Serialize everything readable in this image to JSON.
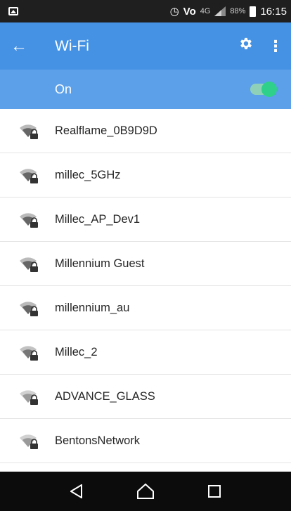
{
  "status_bar": {
    "alarm_icon": "alarm-icon",
    "volte": "Vo",
    "network_type": "4G",
    "battery": "88%",
    "time": "16:15"
  },
  "app_bar": {
    "back_icon": "arrow-left-icon",
    "title": "Wi-Fi",
    "settings_icon": "gear-icon",
    "more_icon": "more-vert-icon"
  },
  "wifi_switch": {
    "label": "On",
    "enabled": true
  },
  "networks": [
    {
      "name": "Realflame_0B9D9D",
      "secured": true
    },
    {
      "name": "millec_5GHz",
      "secured": true
    },
    {
      "name": "Millec_AP_Dev1",
      "secured": true
    },
    {
      "name": "Millennium Guest",
      "secured": true
    },
    {
      "name": "millennium_au",
      "secured": true
    },
    {
      "name": "Millec_2",
      "secured": true
    },
    {
      "name": "ADVANCE_GLASS",
      "secured": true
    },
    {
      "name": "BentonsNetwork",
      "secured": true
    }
  ],
  "nav_bar": {
    "back": "back-triangle-icon",
    "home": "home-icon",
    "recents": "recents-square-icon"
  },
  "colors": {
    "app_bar": "#4592e4",
    "switch_bar": "#5ca0ea",
    "toggle_on": "#2fd08a",
    "status_bar": "#1f1f1f",
    "nav_bar": "#0c0c0c"
  }
}
